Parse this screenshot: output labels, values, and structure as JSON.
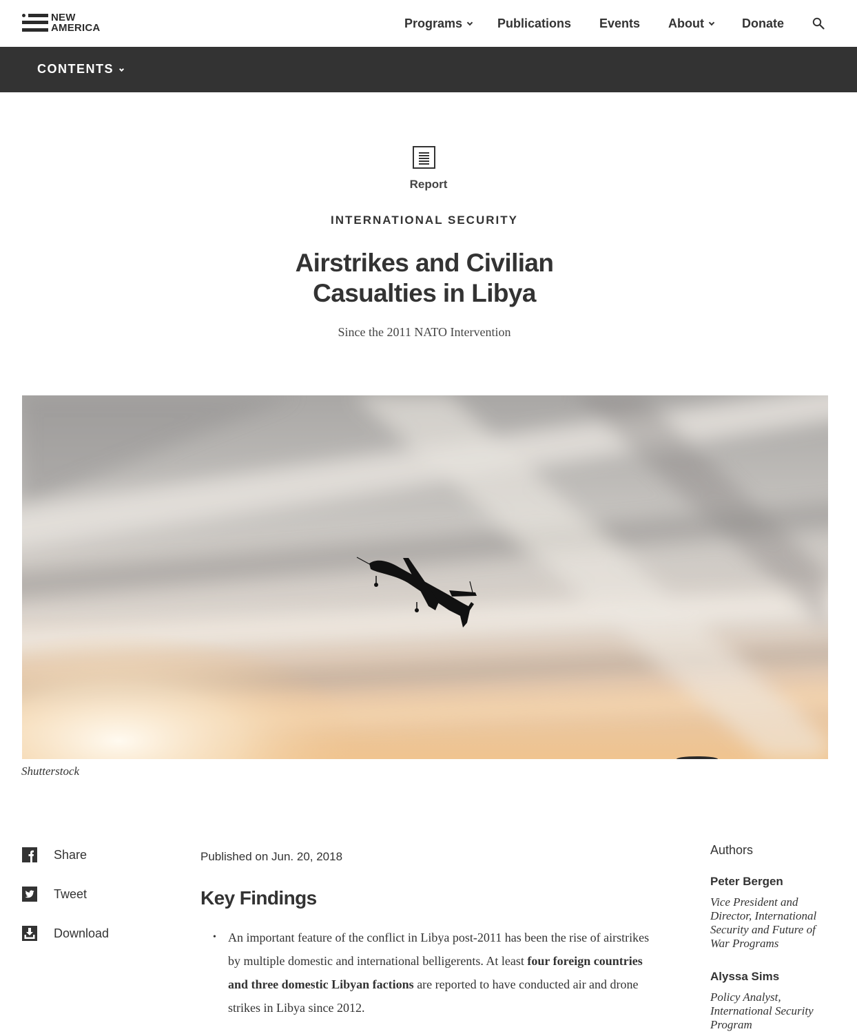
{
  "header": {
    "logo": {
      "line1": "NEW",
      "line2": "AMERICA"
    },
    "nav": [
      {
        "label": "Programs",
        "has_dropdown": true
      },
      {
        "label": "Publications",
        "has_dropdown": false
      },
      {
        "label": "Events",
        "has_dropdown": false
      },
      {
        "label": "About",
        "has_dropdown": true
      },
      {
        "label": "Donate",
        "has_dropdown": false
      }
    ],
    "search_icon": "search-icon"
  },
  "contents_bar": {
    "label": "CONTENTS"
  },
  "hero": {
    "type_label": "Report",
    "program": "INTERNATIONAL SECURITY",
    "title_line1": "Airstrikes and Civilian",
    "title_line2": "Casualties in Libya",
    "subtitle": "Since the 2011 NATO Intervention",
    "image_caption": "Shutterstock"
  },
  "share": [
    {
      "label": "Share",
      "icon": "facebook-icon"
    },
    {
      "label": "Tweet",
      "icon": "twitter-icon"
    },
    {
      "label": "Download",
      "icon": "download-icon"
    }
  ],
  "article": {
    "published": "Published on Jun. 20, 2018",
    "key_findings_heading": "Key Findings",
    "finding1": {
      "text_before": "An important feature of the conflict in Libya post-2011 has been the rise of airstrikes by multiple domestic and international belligerents. At least ",
      "text_bold": "four foreign countries and three domestic Libyan factions",
      "text_after": " are reported to have conducted air and drone strikes in Libya since 2012."
    }
  },
  "authors": {
    "title": "Authors",
    "list": [
      {
        "name": "Peter Bergen",
        "role": "Vice President and Director, International Security and Future of War Programs"
      },
      {
        "name": "Alyssa Sims",
        "role": "Policy Analyst, International Security Program"
      }
    ]
  },
  "colors": {
    "text": "#333333",
    "contents_bar": "#333333",
    "background": "#ffffff"
  }
}
